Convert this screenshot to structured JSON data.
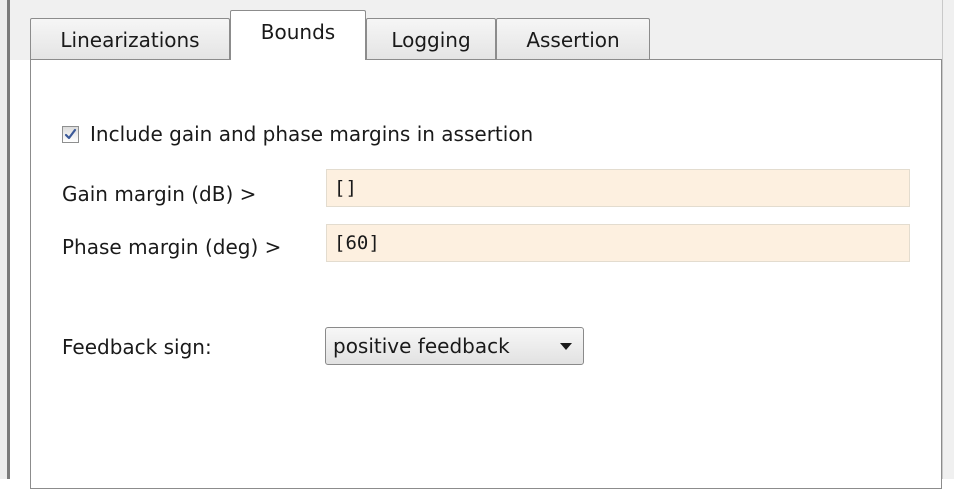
{
  "tabs": [
    {
      "label": "Linearizations",
      "active": false
    },
    {
      "label": "Bounds",
      "active": true
    },
    {
      "label": "Logging",
      "active": false
    },
    {
      "label": "Assertion",
      "active": false
    }
  ],
  "panel": {
    "include_margins": {
      "label": "Include gain and phase margins in assertion",
      "checked": true
    },
    "gain_margin": {
      "label": "Gain margin (dB) >",
      "value": "[]"
    },
    "phase_margin": {
      "label": "Phase margin (deg) >",
      "value": "[60]"
    },
    "feedback_sign": {
      "label": "Feedback sign:",
      "selected": "positive feedback",
      "icon": "chevron-down-icon"
    }
  },
  "colors": {
    "field_background": "#fdf0e0",
    "checkmark": "#3b5998",
    "panel_background": "#ffffff",
    "chrome_background": "#f0f0f0"
  }
}
